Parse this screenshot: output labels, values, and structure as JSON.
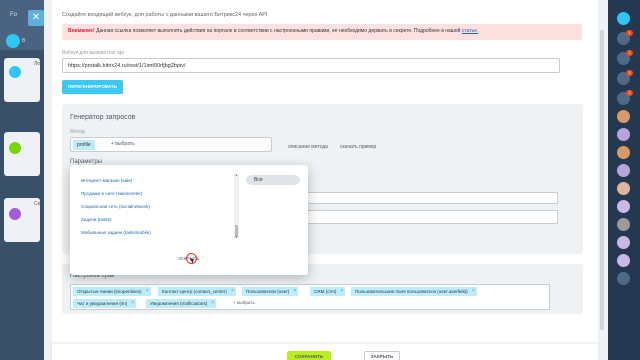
{
  "background": {
    "tab_label": "Fo",
    "side_label_1": "В",
    "card_text_1": "Ло",
    "card_text_2": "Се"
  },
  "intro_text": "Создайте входящий вебхук, для работы с данными вашего Битрикс24 через API",
  "warning": {
    "label": "Внимание!",
    "text": "Данная ссылка позволяет выполнять действия на портале в соответствии с настроенными правами, ее необходимо держать в секрете. Подробнее в нашей",
    "link": "статье."
  },
  "webhook": {
    "label": "Вебхук для вызова rest api",
    "value": "https://protalk.bitrix24.ru/rest/1/1imt90rfjbg2bpiv/",
    "regen_label": "ПЕРЕГЕНЕРИРОВАТЬ"
  },
  "generator": {
    "title": "Генератор запросов",
    "method_label": "Метод",
    "method_value": "profile",
    "choose_label": "+ выбрать",
    "describe_link": "описание метода",
    "example_link": "скачать пример",
    "params_label": "Параметры"
  },
  "popup": {
    "items": [
      "Интернет-магазин (sale)",
      "Продажи в чате (salescenter)",
      "Социальная сеть (socialnetwork)",
      "Задачи (tasks)",
      "Мобильные задачи (tasksmobile)"
    ],
    "all_label": "Все",
    "close_label": "ЗАКРЫТЬ"
  },
  "permissions": {
    "title": "Настройка прав",
    "tags": [
      "Открытые линии (imopenlines)",
      "Контакт-центр (contact_center)",
      "Пользователи (user)",
      "CRM (crm)",
      "Пользовательские поля пользователя (user.userfield)",
      "Чат и уведомления (im)",
      "Уведомления (notifications)"
    ],
    "choose_label": "+ выбрать"
  },
  "footer": {
    "save_label": "СОХРАНИТЬ",
    "cancel_label": "ЗАКРЫТЬ"
  },
  "right_sidebar": {
    "badges": [
      "1",
      "2",
      "3",
      "3"
    ]
  },
  "colors": {
    "accent": "#3bc8f5",
    "save": "#bbed21",
    "tag": "#bcedfc",
    "warning_bg": "#fde1e1",
    "sidebar": "#24394f"
  }
}
